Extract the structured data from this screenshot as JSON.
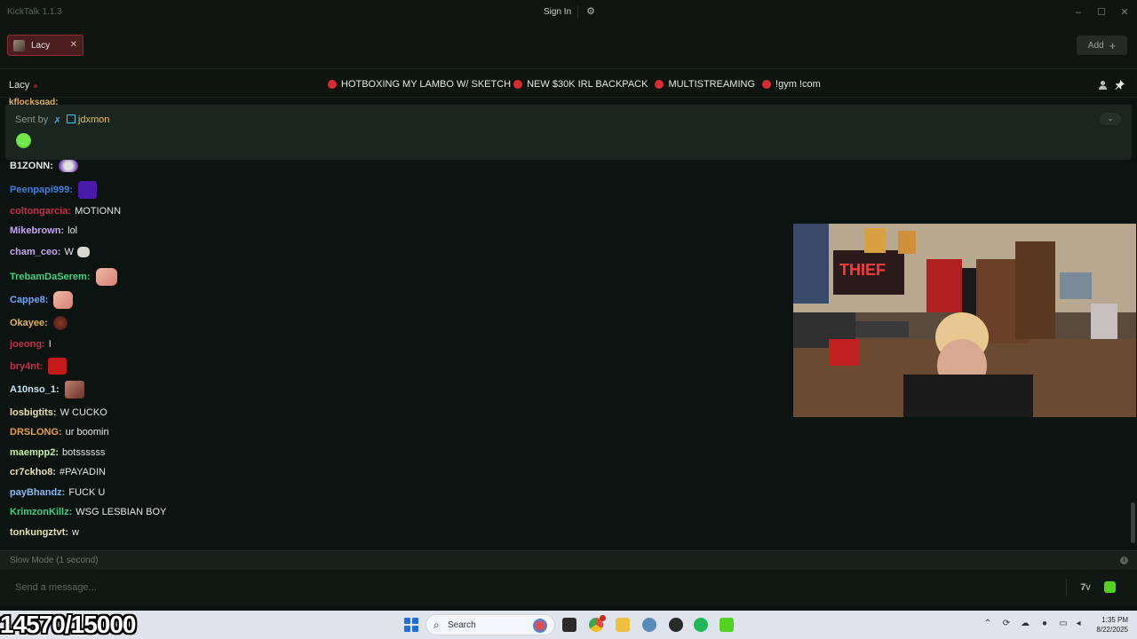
{
  "app": {
    "title": "KickTalk 1.1.3",
    "sign_in": "Sign In"
  },
  "tabs": [
    {
      "label": "Lacy"
    }
  ],
  "add_button": "Add",
  "channel": {
    "name": "Lacy",
    "title_segments": [
      "HOTBOXING MY LAMBO W/ SKETCH",
      "NEW $30K IRL BACKPACK",
      "MULTISTREAMING",
      "!gym !com"
    ]
  },
  "pinned": {
    "sent_by_label": "Sent by",
    "user": "jdxmon"
  },
  "peek_user": "kflocksgad:",
  "messages": [
    {
      "user": "B1ZONN:",
      "text": "",
      "color": "#e4e6e4"
    },
    {
      "user": "Peenpapi999:",
      "text": "",
      "color": "#3f7fe0"
    },
    {
      "user": "coltongarcia:",
      "text": "MOTIONN",
      "color": "#c7304a"
    },
    {
      "user": "Mikebrown:",
      "text": "lol",
      "color": "#c9a6f0"
    },
    {
      "user": "cham_ceo:",
      "text": "W",
      "color": "#c9a6f0"
    },
    {
      "user": "TrebamDaSerem:",
      "text": "",
      "color": "#3fd08a"
    },
    {
      "user": "Cappe8:",
      "text": "",
      "color": "#6fa6ff"
    },
    {
      "user": "Okayee:",
      "text": "",
      "color": "#e4b25a"
    },
    {
      "user": "joeong:",
      "text": "I",
      "color": "#c7304a"
    },
    {
      "user": "bry4nt:",
      "text": "",
      "color": "#c7304a"
    },
    {
      "user": "A10nso_1:",
      "text": "",
      "color": "#c9e4f0"
    },
    {
      "user": "losbigtits:",
      "text": "W CUCKO",
      "color": "#e8e0b0"
    },
    {
      "user": "DRSLONG:",
      "text": "ur boomin",
      "color": "#e4a04a"
    },
    {
      "user": "maempp2:",
      "text": "botssssss",
      "color": "#c9f0a6"
    },
    {
      "user": "cr7ckho8:",
      "text": "#PAYADIN",
      "color": "#e8e0b0"
    },
    {
      "user": "payBhandz:",
      "text": "FUCK U",
      "color": "#8ab8f0"
    },
    {
      "user": "KrimzonKillz:",
      "text": "WSG LESBIAN BOY",
      "color": "#3fd08a"
    },
    {
      "user": "tonkungztvt:",
      "text": "w",
      "color": "#e8e0b0"
    }
  ],
  "slow_mode": "Slow Mode (1 second)",
  "input": {
    "placeholder": "Send a message..."
  },
  "overlay_counter": "14570/15000",
  "taskbar": {
    "search_label": "Search",
    "time": "1:35 PM",
    "date": "8/22/2025"
  }
}
